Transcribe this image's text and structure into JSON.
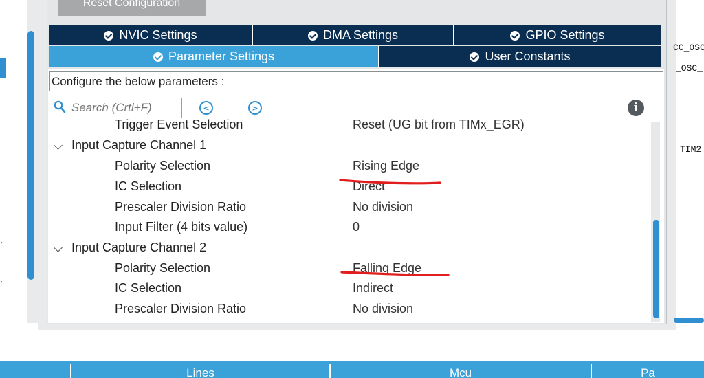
{
  "toolbar": {
    "reset_label": "Reset Configuration"
  },
  "tabs_row1": [
    {
      "label": "NVIC Settings"
    },
    {
      "label": "DMA Settings"
    },
    {
      "label": "GPIO Settings"
    }
  ],
  "tabs_row2": [
    {
      "label": "Parameter Settings",
      "active": true
    },
    {
      "label": "User Constants"
    }
  ],
  "config_text": "Configure the below parameters :",
  "search": {
    "placeholder": "Search (Crtl+F)",
    "value": ""
  },
  "nav": {
    "prev_icon": "chevron-left-circle-icon",
    "next_icon": "chevron-right-circle-icon"
  },
  "info_glyph": "i",
  "parameters": [
    {
      "label": "Trigger Event Selection",
      "value": "Reset (UG bit from TIMx_EGR)"
    },
    {
      "group": "Input Capture Channel 1"
    },
    {
      "label": "Polarity Selection",
      "value": "Rising Edge"
    },
    {
      "label": "IC Selection",
      "value": "Direct"
    },
    {
      "label": "Prescaler Division Ratio",
      "value": "No division"
    },
    {
      "label": "Input Filter (4 bits value)",
      "value": "0"
    },
    {
      "group": "Input Capture Channel 2"
    },
    {
      "label": "Polarity Selection",
      "value": "Falling Edge"
    },
    {
      "label": "IC Selection",
      "value": "Indirect"
    },
    {
      "label": "Prescaler Division Ratio",
      "value": "No division"
    }
  ],
  "right_panel": {
    "texts": [
      "CC_OSC",
      "_OSC_",
      "TIM2_"
    ]
  },
  "bottom_tabs": [
    {
      "label": ""
    },
    {
      "label": "Lines"
    },
    {
      "label": "Mcu"
    },
    {
      "label": "Pa"
    }
  ],
  "colors": {
    "tab_dark": "#0a2e52",
    "tab_active": "#3aa1d9",
    "accent_blue": "#2f8fd1",
    "annotation_red": "#e01e1e"
  }
}
